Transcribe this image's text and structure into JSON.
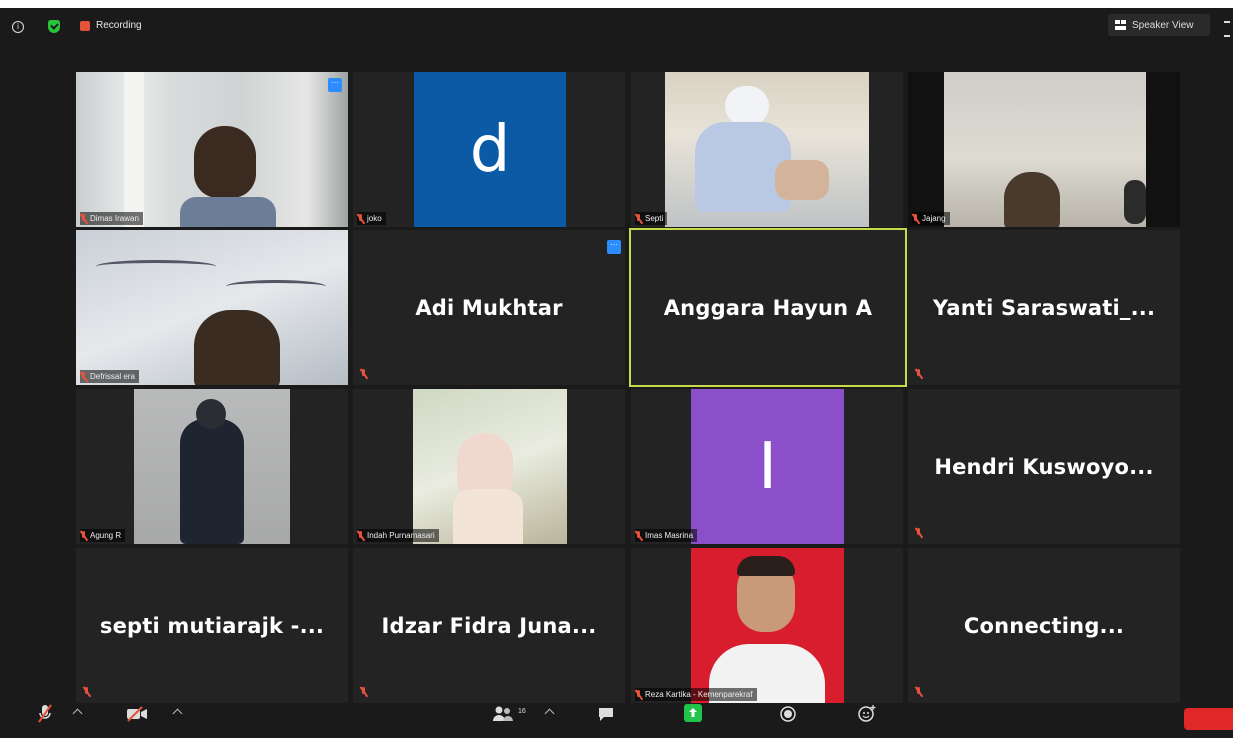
{
  "topbar": {
    "recording_label": "Recording",
    "speaker_view_label": "Speaker View"
  },
  "tiles": {
    "dimas": {
      "name": "Dimas Irawan"
    },
    "joko": {
      "name": "joko",
      "initial": "d"
    },
    "septi": {
      "name": "Septi"
    },
    "jajang": {
      "name": "Jajang"
    },
    "defri": {
      "name": "Defrissal era"
    },
    "adi": {
      "name": "Adi Mukhtar"
    },
    "anggara": {
      "name": "Anggara Hayun A"
    },
    "yanti": {
      "name": "Yanti Saraswati_..."
    },
    "agung": {
      "name": "Agung R"
    },
    "indah": {
      "name": "Indah Purnamasari"
    },
    "imas": {
      "name": "Imas Masrina",
      "initial": "I"
    },
    "hendri": {
      "name": "Hendri Kuswoyo..."
    },
    "septim": {
      "name": "septi mutiarajk -..."
    },
    "idzar": {
      "name": "Idzar Fidra Juna..."
    },
    "reza": {
      "name": "Reza Kartika - Kemenparekraf"
    },
    "connecting": {
      "name": "Connecting..."
    }
  },
  "toolbar": {
    "participants_count": "16"
  },
  "colors": {
    "background": "#1a1a1a",
    "tile": "#232323",
    "active_speaker_border": "#c9d94c",
    "joko_avatar": "#0b5aa6",
    "imas_avatar": "#8a4fc9",
    "accent": "#2d8cff",
    "muted": "#e5533b"
  }
}
